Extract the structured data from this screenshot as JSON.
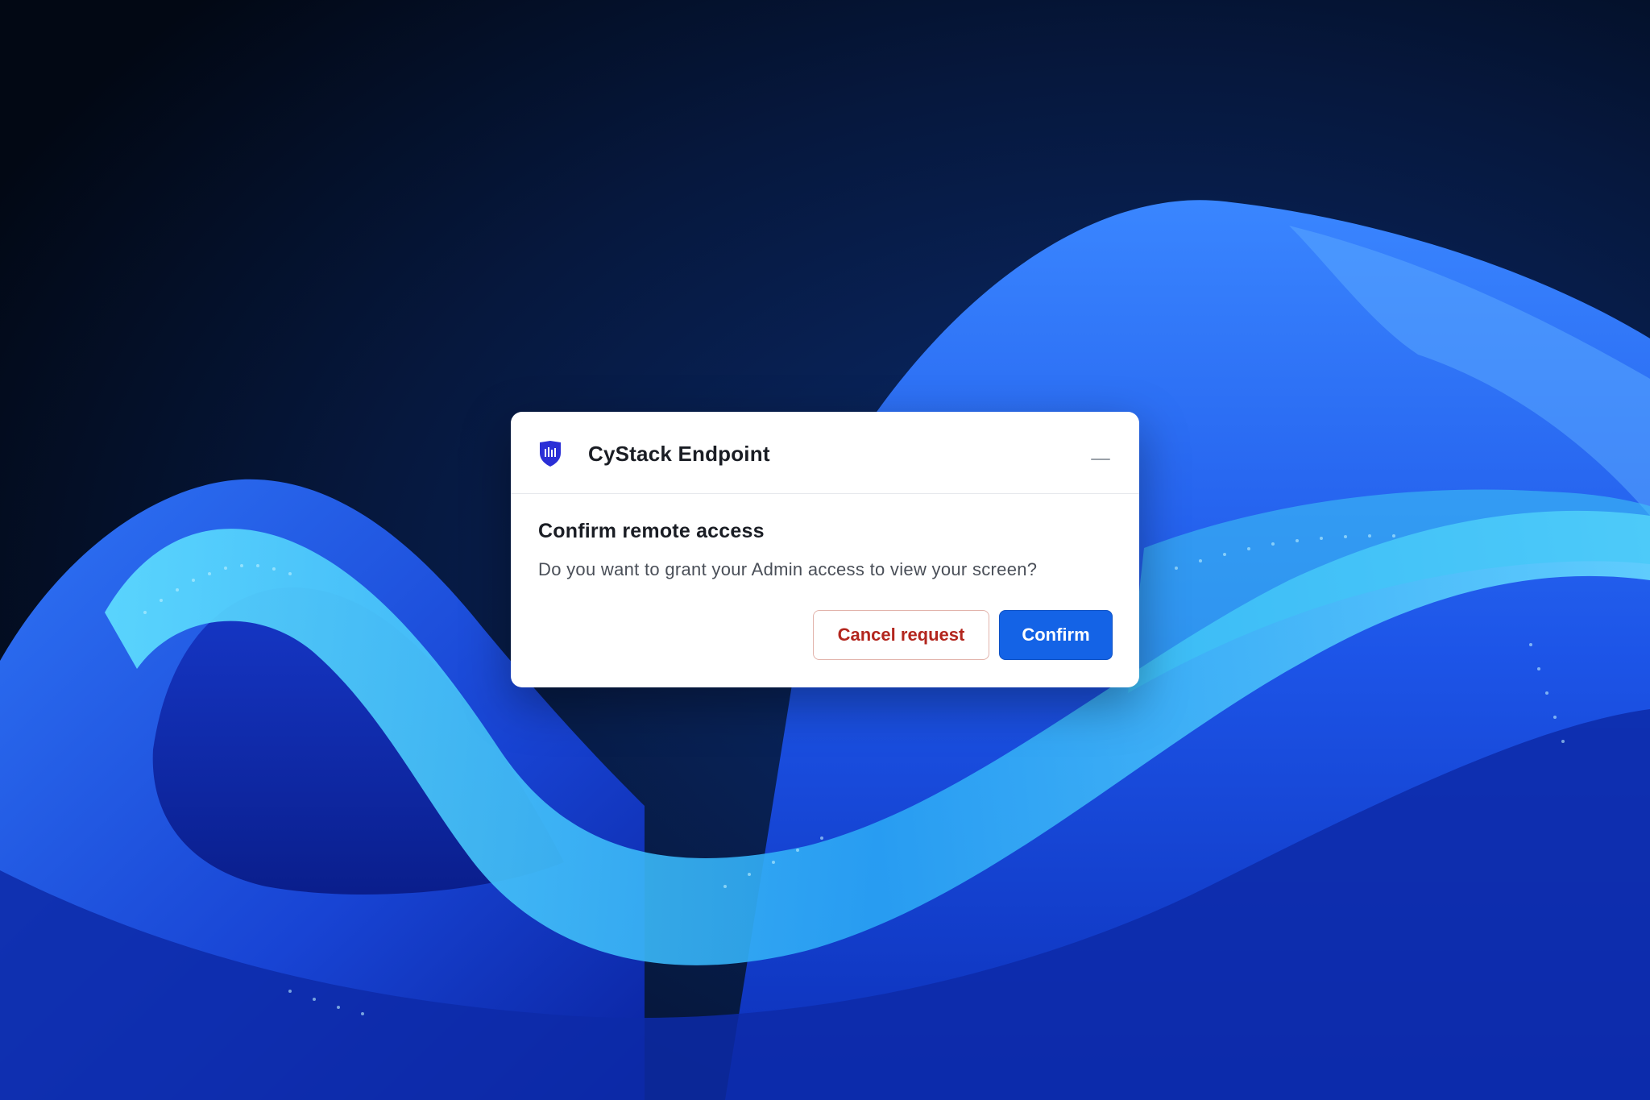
{
  "dialog": {
    "app_name": "CyStack Endpoint",
    "app_icon": "cystack-shield-icon",
    "minimize_icon": "minimize-icon",
    "heading": "Confirm remote access",
    "message": "Do you want to grant your Admin access to view your screen?",
    "cancel_label": "Cancel request",
    "confirm_label": "Confirm"
  },
  "colors": {
    "accent": "#1463e6",
    "danger": "#b3261e",
    "brand_shield": "#2b2fd6",
    "background_dark": "#030a1a",
    "wallpaper_blue": "#1a5cf0",
    "wallpaper_cyan": "#4fd4f0"
  }
}
